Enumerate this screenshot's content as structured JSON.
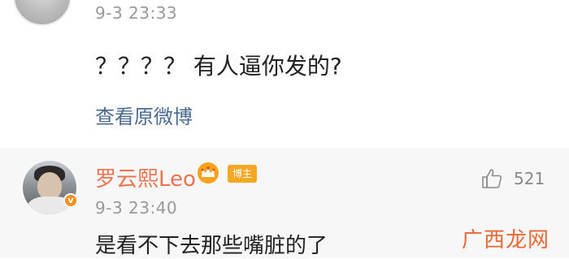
{
  "comment_main": {
    "timestamp": "9-3 23:33",
    "text": "？？？？ 有人逼你发的?",
    "view_original_label": "查看原微博"
  },
  "reply": {
    "username": "罗云熙Leo",
    "badge_label": "博主",
    "timestamp": "9-3 23:40",
    "text": "是看不下去那些嘴脏的了",
    "likes": "521"
  },
  "watermark": {
    "text": "广西龙网"
  },
  "colors": {
    "username": "#eb7350",
    "link": "#4b6a91",
    "reply_background": "#f7f7f7",
    "badge": "#f5a623"
  },
  "icons": {
    "crown": "crown-icon",
    "like": "thumbs-up-icon",
    "verified": "verified-icon"
  }
}
